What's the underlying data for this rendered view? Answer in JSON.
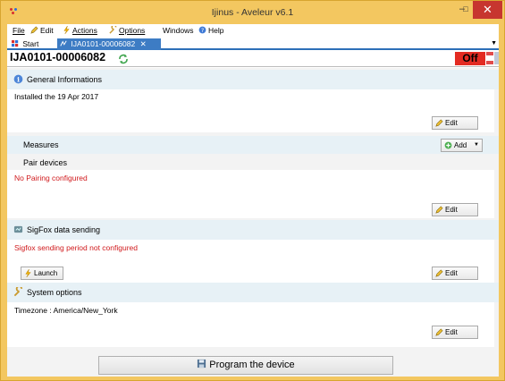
{
  "window": {
    "title": "Ijinus - Aveleur v6.1",
    "min_glyph": "–",
    "max_glyph": "□",
    "close_glyph": "✕"
  },
  "menu": {
    "file": "File",
    "edit": "Edit",
    "actions": "Actions",
    "options": "Options",
    "windows": "Windows",
    "help": "Help"
  },
  "tabs": {
    "start": "Start",
    "device": "IJA0101-00006082",
    "close_glyph": "✕",
    "overflow_glyph": "▼"
  },
  "device": {
    "id": "IJA0101-00006082",
    "status": "Off"
  },
  "general": {
    "title": "General Informations",
    "installed": "Installed the 19 Apr 2017",
    "edit_label": "Edit"
  },
  "measures": {
    "title": "Measures",
    "add_label": "Add"
  },
  "pair": {
    "title": "Pair devices",
    "status": "No Pairing configured",
    "edit_label": "Edit"
  },
  "sigfox": {
    "title": "SigFox data sending",
    "status": "Sigfox sending period not configured",
    "launch_label": "Launch",
    "edit_label": "Edit"
  },
  "system": {
    "title": "System options",
    "timezone": "Timezone : America/New_York",
    "edit_label": "Edit"
  },
  "program": {
    "label": "Program the device"
  },
  "colors": {
    "window_frame": "#f3c760",
    "close_button": "#c7362f",
    "active_tab": "#3d7cc4",
    "off_badge": "#e32b22",
    "error_text": "#d0191c",
    "section_header": "#e7f1f6"
  }
}
